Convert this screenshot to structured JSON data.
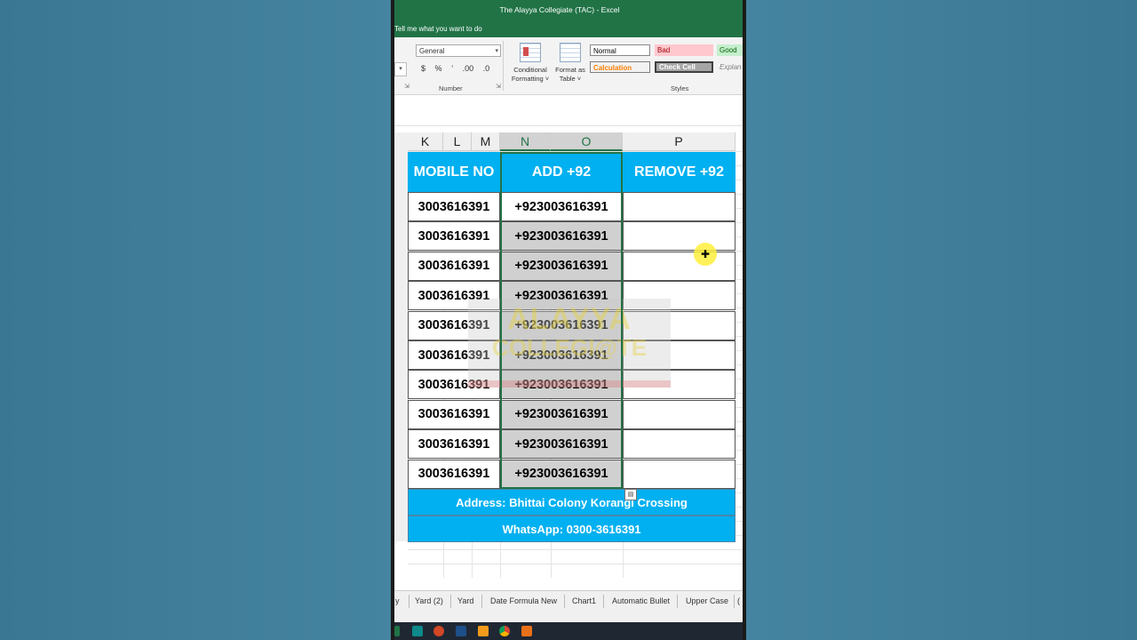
{
  "window": {
    "title": "The Alayya Collegiate (TAC)  -  Excel",
    "tell_me": "Tell me what you want to do"
  },
  "ribbon": {
    "number_format": "General",
    "number_tools": [
      "$",
      "%",
      "’",
      ".00",
      ".0"
    ],
    "number_group": "Number",
    "conditional_formatting": [
      "Conditional",
      "Formatting ˅"
    ],
    "format_as_table": [
      "Format as",
      "Table ˅"
    ],
    "styles_group": "Styles",
    "styles": {
      "normal": "Normal",
      "bad": "Bad",
      "good": "Good",
      "calculation": "Calculation",
      "check_cell": "Check Cell",
      "explanatory": "Explan"
    }
  },
  "columns": [
    "K",
    "L",
    "M",
    "N",
    "O",
    "P"
  ],
  "table": {
    "headers": [
      "MOBILE NO",
      "ADD +92",
      "REMOVE +92"
    ],
    "rows": [
      [
        "3003616391",
        "+923003616391",
        ""
      ],
      [
        "3003616391",
        "+923003616391",
        ""
      ],
      [
        "3003616391",
        "+923003616391",
        ""
      ],
      [
        "3003616391",
        "+923003616391",
        ""
      ],
      [
        "3003616391",
        "+923003616391",
        ""
      ],
      [
        "3003616391",
        "+923003616391",
        ""
      ],
      [
        "3003616391",
        "+923003616391",
        ""
      ],
      [
        "3003616391",
        "+923003616391",
        ""
      ],
      [
        "3003616391",
        "+923003616391",
        ""
      ],
      [
        "3003616391",
        "+923003616391",
        ""
      ]
    ],
    "address": "Address: Bhittai Colony Korangi Crossing",
    "whatsapp": "WhatsApp: 0300-3616391"
  },
  "watermark": {
    "line1": "ALAYYA",
    "line2": "COLLEGI@TE"
  },
  "sheet_tabs": [
    "y",
    "Yard (2)",
    "Yard",
    "Date Formula New",
    "Chart1",
    "Automatic Bullet",
    "Upper Case",
    "("
  ],
  "colors": {
    "header_blue": "#00b0f0",
    "excel_green": "#217346",
    "selection_gray": "#d0d0d0"
  }
}
